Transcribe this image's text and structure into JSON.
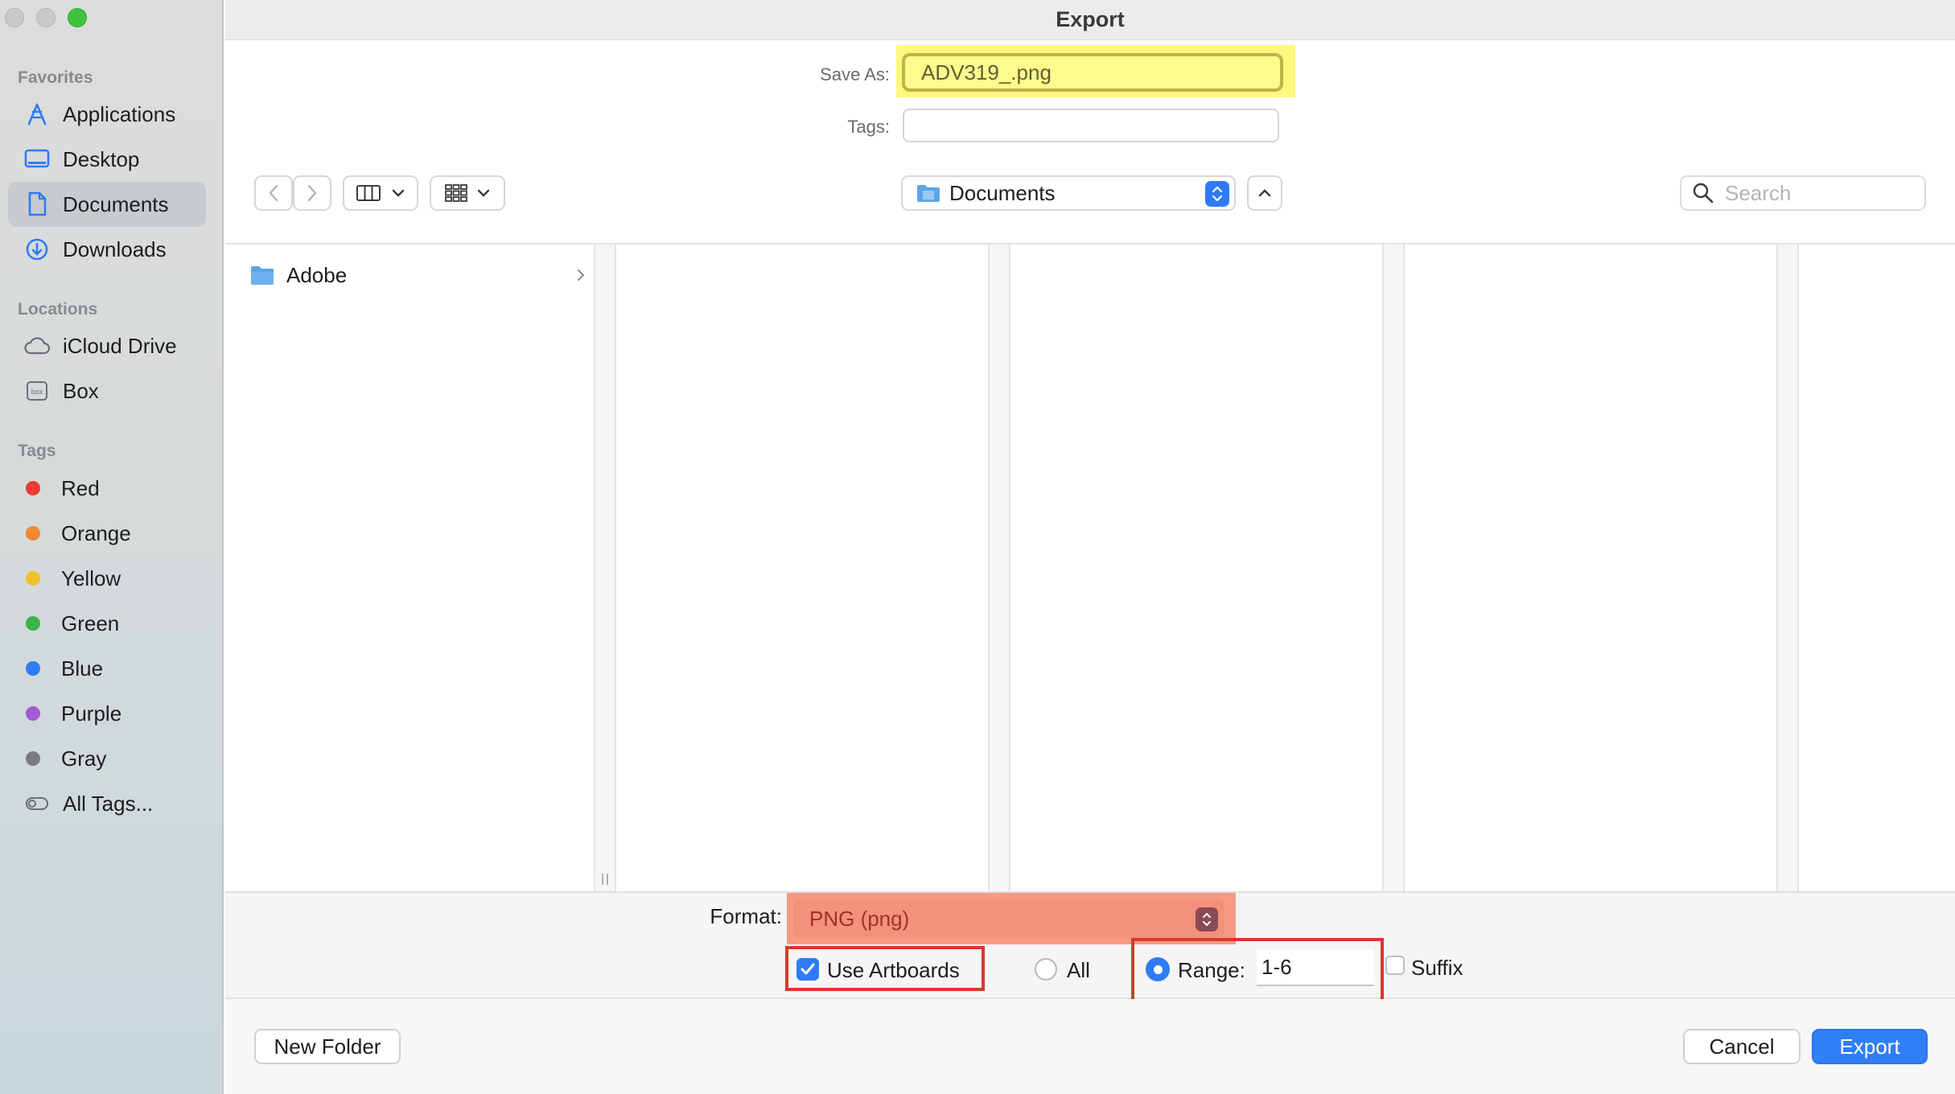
{
  "window": {
    "title": "Export"
  },
  "sidebar": {
    "favorites_label": "Favorites",
    "favorites": [
      {
        "label": "Applications",
        "icon": "applications-icon"
      },
      {
        "label": "Desktop",
        "icon": "desktop-icon"
      },
      {
        "label": "Documents",
        "icon": "document-icon",
        "selected": true
      },
      {
        "label": "Downloads",
        "icon": "downloads-icon"
      }
    ],
    "locations_label": "Locations",
    "locations": [
      {
        "label": "iCloud Drive",
        "icon": "cloud-icon"
      },
      {
        "label": "Box",
        "icon": "box-icon"
      }
    ],
    "tags_label": "Tags",
    "tags": [
      {
        "label": "Red",
        "color": "#ee3b33"
      },
      {
        "label": "Orange",
        "color": "#ef8b2c"
      },
      {
        "label": "Yellow",
        "color": "#f3c02d"
      },
      {
        "label": "Green",
        "color": "#39b54a"
      },
      {
        "label": "Blue",
        "color": "#2f7bf6"
      },
      {
        "label": "Purple",
        "color": "#a45bd0"
      },
      {
        "label": "Gray",
        "color": "#7b7b7f"
      }
    ],
    "all_tags": "All Tags..."
  },
  "form": {
    "save_as_label": "Save As:",
    "save_as_value": "ADV319_.png",
    "tags_label": "Tags:",
    "tags_value": ""
  },
  "toolbar": {
    "location": "Documents",
    "search_placeholder": "Search"
  },
  "browser": {
    "items": [
      {
        "name": "Adobe",
        "type": "folder"
      }
    ]
  },
  "options": {
    "format_label": "Format:",
    "format_value": "PNG (png)",
    "use_artboards_label": "Use Artboards",
    "use_artboards_checked": true,
    "all_label": "All",
    "range_label": "Range:",
    "range_value": "1-6",
    "suffix_label": "Suffix"
  },
  "footer": {
    "new_folder": "New Folder",
    "cancel": "Cancel",
    "export": "Export"
  },
  "colors": {
    "accent": "#2f7bf6",
    "highlight_yellow": "#fff87e",
    "highlight_red": "#f69a84",
    "annotation_red": "#d63a2b"
  }
}
